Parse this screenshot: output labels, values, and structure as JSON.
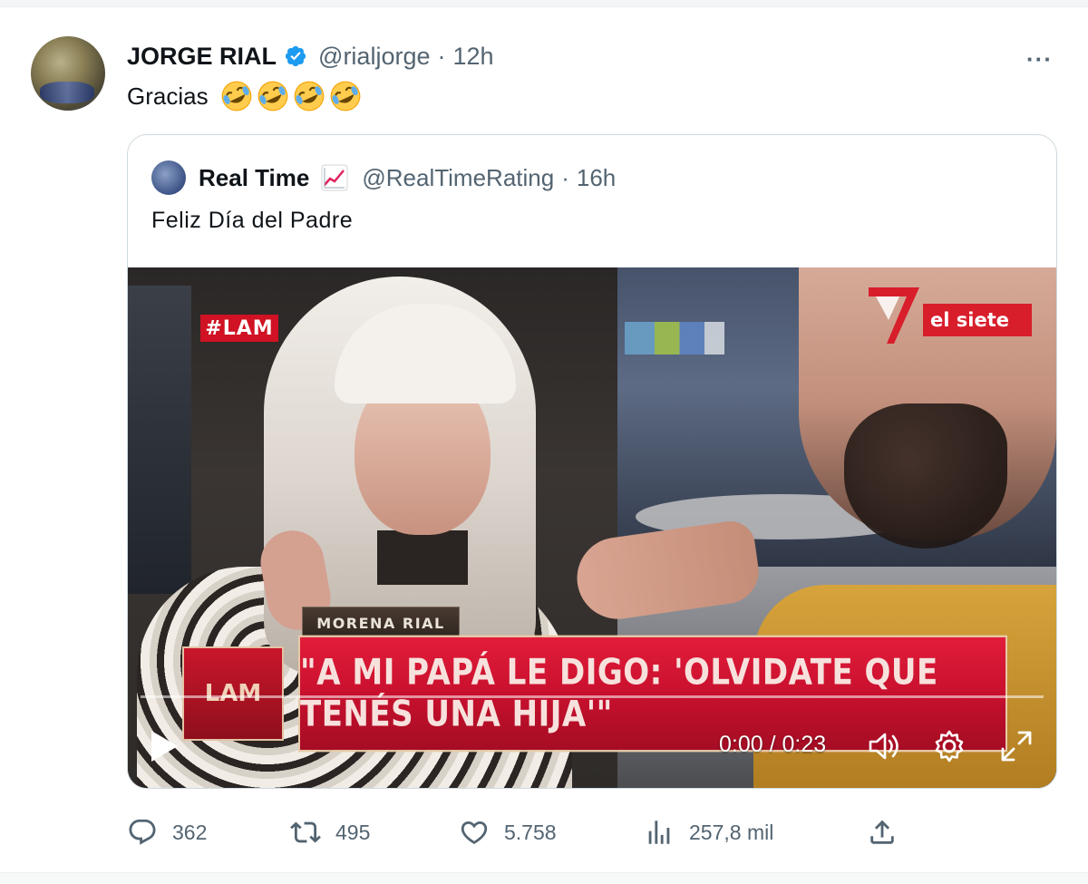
{
  "tweet": {
    "author_name": "JORGE RIAL",
    "author_handle": "@rialjorge",
    "separator": "·",
    "time": "12h",
    "more_label": "···",
    "text": "Gracias",
    "emoji_count_icons": [
      "rolling-on-floor-laughing",
      "rolling-on-floor-laughing",
      "rolling-on-floor-laughing",
      "rolling-on-floor-laughing"
    ]
  },
  "quote": {
    "author_name": "Real Time",
    "author_handle": "@RealTimeRating",
    "separator": "·",
    "time": "16h",
    "text": "Feliz Día del Padre",
    "video": {
      "channel_tag": "#LAM",
      "channel_logo_text": "el siete",
      "name_plate": "MORENA RIAL",
      "lower_logo": "LAM",
      "headline": "\"A MI PAPÁ LE DIGO: 'OLVIDATE QUE TENÉS UNA HIJA'\"",
      "time_readout": "0:00 / 0:23",
      "progress": 0.0
    }
  },
  "actions": {
    "replies": "362",
    "retweets": "495",
    "likes": "5.758",
    "views": "257,8 mil"
  },
  "colors": {
    "verified": "#1d9bf0",
    "secondary_text": "#536471",
    "border": "#cfd9de",
    "banner_red": "#c8102e"
  }
}
